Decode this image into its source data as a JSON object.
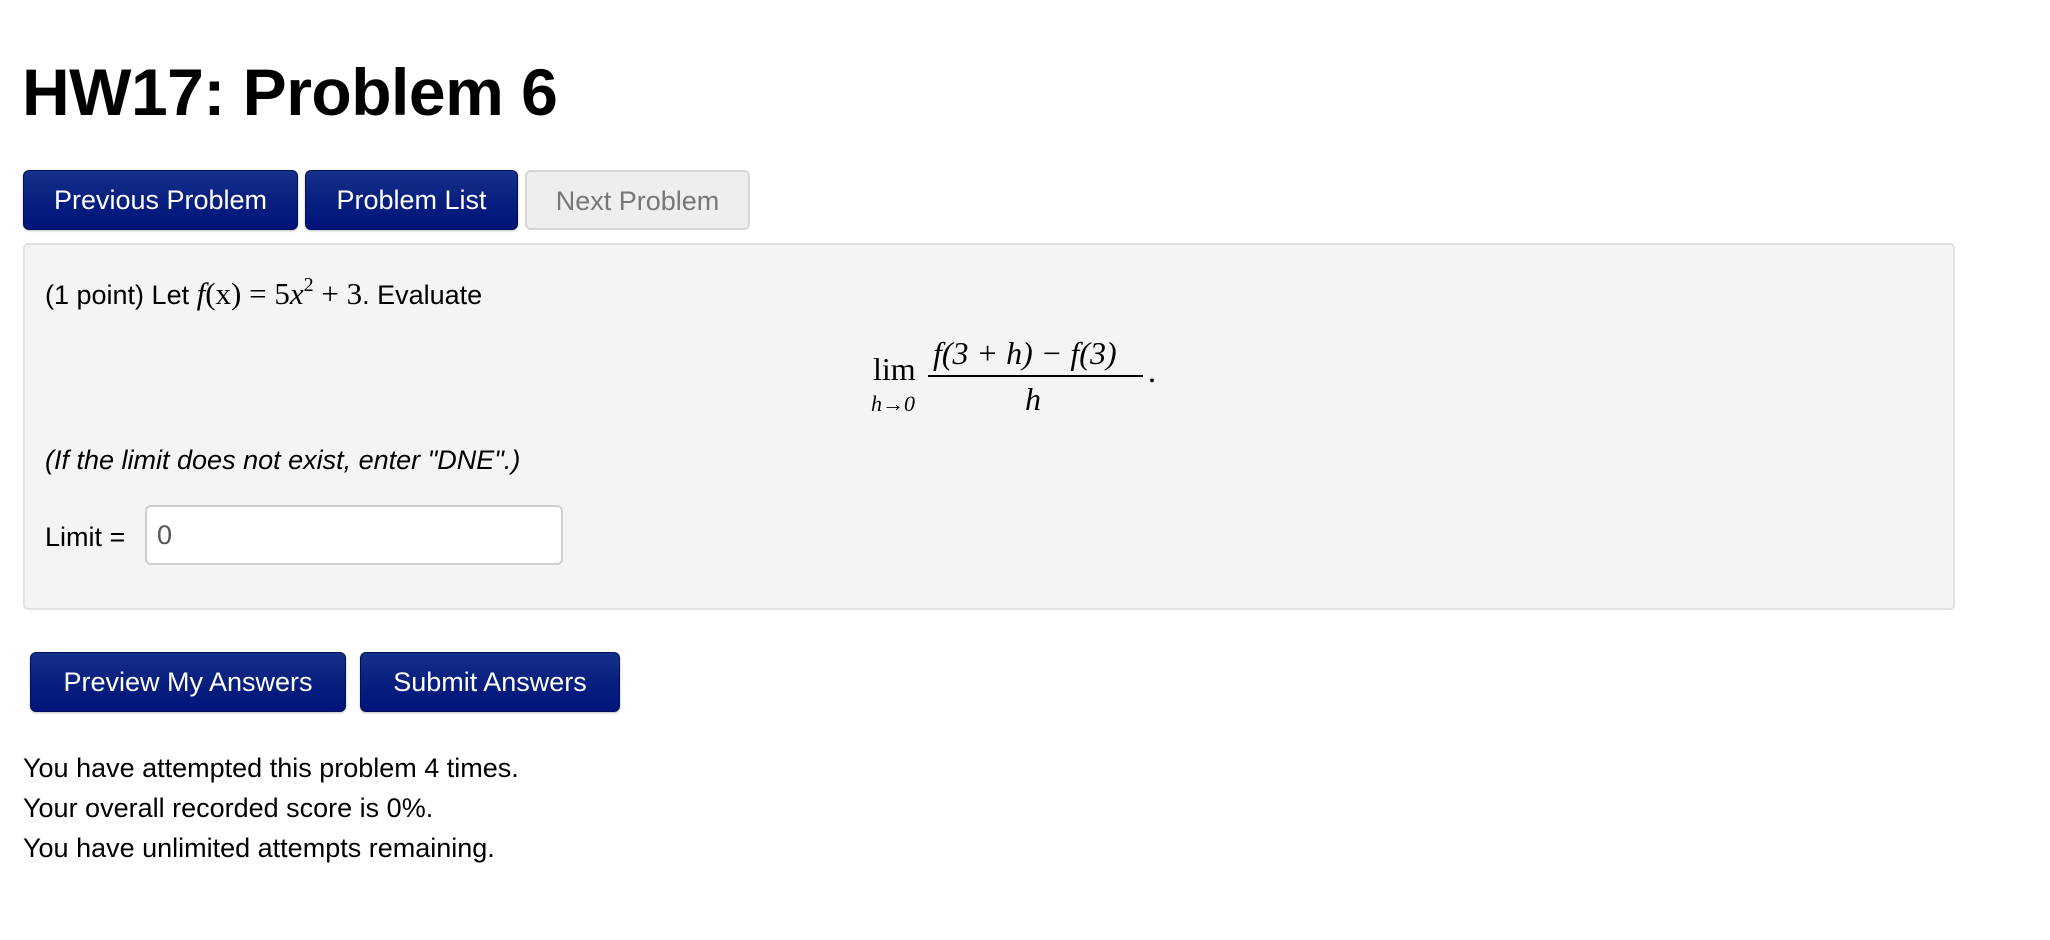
{
  "header": {
    "title": "HW17: Problem 6"
  },
  "nav": {
    "previous_label": "Previous Problem",
    "list_label": "Problem List",
    "next_label": "Next Problem",
    "next_disabled": true
  },
  "problem": {
    "points_text": "(1 point) Let ",
    "function_name": "f",
    "function_arg": "(x)",
    "equals": " = ",
    "coef": "5",
    "var": "x",
    "exponent": "2",
    "plus_term": " + 3",
    "evaluate_text": ". Evaluate",
    "limit_display": {
      "operator": "lim",
      "subscript": "h→0",
      "numerator": "f(3 + h) − f(3)",
      "denominator": "h",
      "trailing": "."
    },
    "hint": "(If the limit does not exist, enter \"DNE\".)",
    "answer_label": "Limit =",
    "answer_value": "0"
  },
  "actions": {
    "preview_label": "Preview My Answers",
    "submit_label": "Submit Answers"
  },
  "status": {
    "attempts": "You have attempted this problem 4 times.",
    "score": "Your overall recorded score is 0%.",
    "remaining": "You have unlimited attempts remaining."
  },
  "colors": {
    "primary_button": "#0a2180",
    "panel_background": "#f4f4f4",
    "disabled_button": "#eeeeee"
  }
}
